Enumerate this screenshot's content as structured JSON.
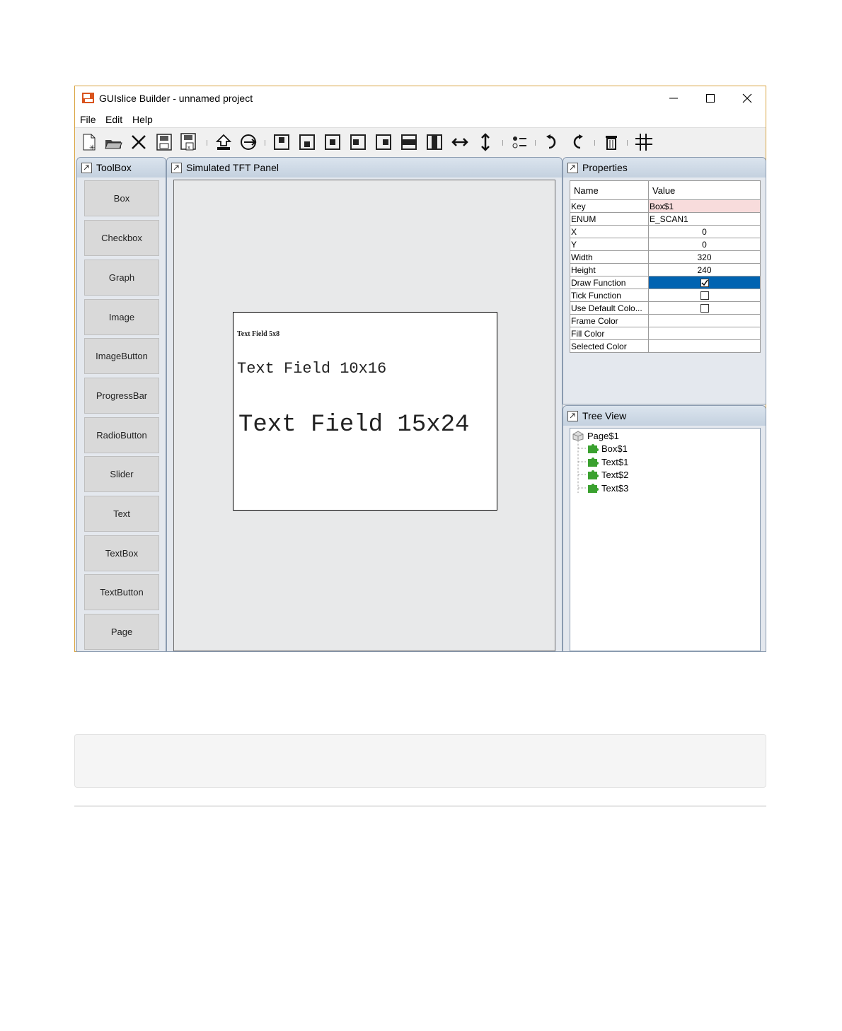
{
  "window": {
    "title": "GUIslice Builder - unnamed project",
    "controls": [
      "minimize-icon",
      "maximize-icon",
      "close-icon"
    ]
  },
  "menu": [
    "File",
    "Edit",
    "Help"
  ],
  "toolbar": [
    "new-project-icon",
    "open-project-icon",
    "close-project-icon",
    "save-icon",
    "save-as-icon",
    "export-icon",
    "code-gen-icon",
    "align-top-icon",
    "align-bottom-icon",
    "align-center-icon",
    "align-left-icon",
    "align-right-icon",
    "align-horizontal-icon",
    "align-vertical-icon",
    "space-horizontal-icon",
    "space-vertical-icon",
    "group-icon",
    "undo-icon",
    "redo-icon",
    "delete-icon",
    "grid-icon"
  ],
  "toolbox": {
    "title": "ToolBox",
    "items": [
      "Box",
      "Checkbox",
      "Graph",
      "Image",
      "ImageButton",
      "ProgressBar",
      "RadioButton",
      "Slider",
      "Text",
      "TextBox",
      "TextButton",
      "Page"
    ]
  },
  "tft": {
    "title": "Simulated TFT Panel",
    "text1": "Text Field 5x8",
    "text2": "Text Field 10x16",
    "text3": "Text Field 15x24"
  },
  "properties": {
    "title": "Properties",
    "header_name": "Name",
    "header_value": "Value",
    "rows": [
      {
        "name": "Key",
        "value": "Box$1"
      },
      {
        "name": "ENUM",
        "value": "E_SCAN1"
      },
      {
        "name": "X",
        "value": "0"
      },
      {
        "name": "Y",
        "value": "0"
      },
      {
        "name": "Width",
        "value": "320"
      },
      {
        "name": "Height",
        "value": "240"
      },
      {
        "name": "Draw Function",
        "value": "checked"
      },
      {
        "name": "Tick Function",
        "value": "unchecked"
      },
      {
        "name": "Use Default Colo...",
        "value": "unchecked"
      },
      {
        "name": "Frame Color",
        "value": ""
      },
      {
        "name": "Fill Color",
        "value": ""
      },
      {
        "name": "Selected Color",
        "value": ""
      }
    ]
  },
  "tree": {
    "title": "Tree View",
    "root": "Page$1",
    "children": [
      "Box$1",
      "Text$1",
      "Text$2",
      "Text$3"
    ]
  },
  "colors": {
    "selection": "#0063b1",
    "key_highlight": "#f8dcdc",
    "panel_border": "#8a9bb0",
    "tree_icon": "#3aa12f"
  }
}
